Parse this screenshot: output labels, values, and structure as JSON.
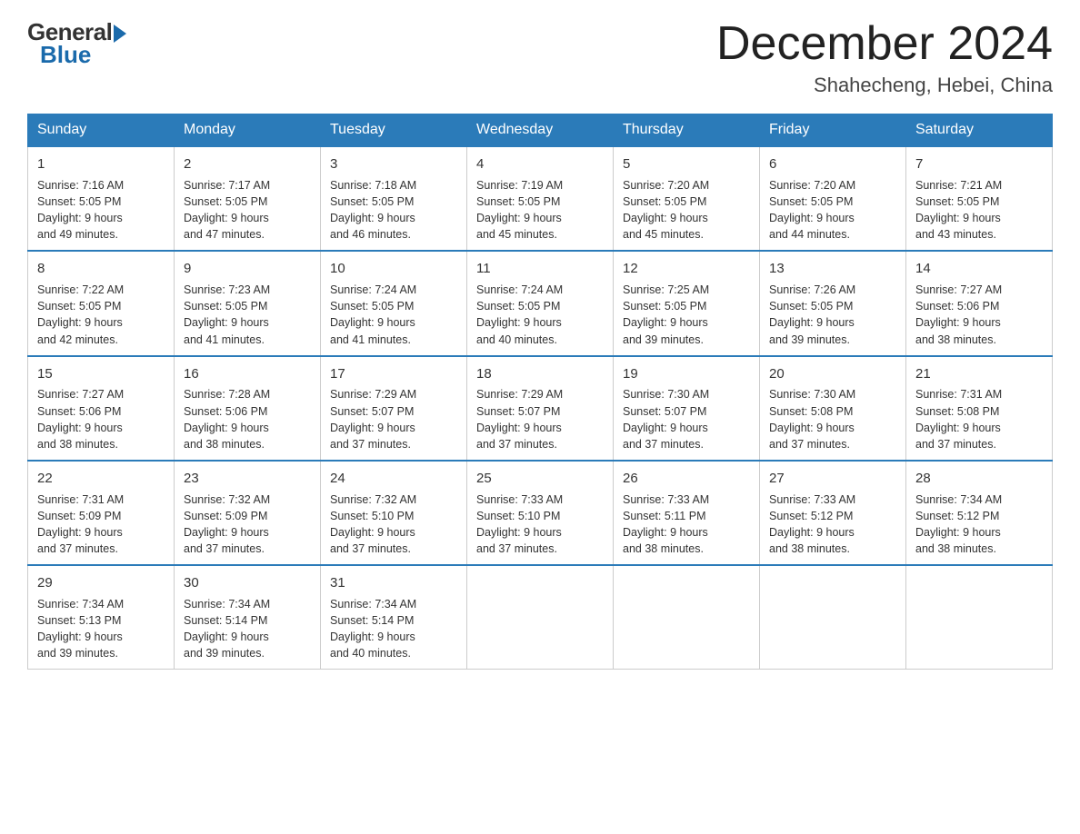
{
  "logo": {
    "general": "General",
    "blue": "Blue"
  },
  "title": "December 2024",
  "location": "Shahecheng, Hebei, China",
  "headers": [
    "Sunday",
    "Monday",
    "Tuesday",
    "Wednesday",
    "Thursday",
    "Friday",
    "Saturday"
  ],
  "weeks": [
    [
      {
        "day": "1",
        "info": "Sunrise: 7:16 AM\nSunset: 5:05 PM\nDaylight: 9 hours\nand 49 minutes."
      },
      {
        "day": "2",
        "info": "Sunrise: 7:17 AM\nSunset: 5:05 PM\nDaylight: 9 hours\nand 47 minutes."
      },
      {
        "day": "3",
        "info": "Sunrise: 7:18 AM\nSunset: 5:05 PM\nDaylight: 9 hours\nand 46 minutes."
      },
      {
        "day": "4",
        "info": "Sunrise: 7:19 AM\nSunset: 5:05 PM\nDaylight: 9 hours\nand 45 minutes."
      },
      {
        "day": "5",
        "info": "Sunrise: 7:20 AM\nSunset: 5:05 PM\nDaylight: 9 hours\nand 45 minutes."
      },
      {
        "day": "6",
        "info": "Sunrise: 7:20 AM\nSunset: 5:05 PM\nDaylight: 9 hours\nand 44 minutes."
      },
      {
        "day": "7",
        "info": "Sunrise: 7:21 AM\nSunset: 5:05 PM\nDaylight: 9 hours\nand 43 minutes."
      }
    ],
    [
      {
        "day": "8",
        "info": "Sunrise: 7:22 AM\nSunset: 5:05 PM\nDaylight: 9 hours\nand 42 minutes."
      },
      {
        "day": "9",
        "info": "Sunrise: 7:23 AM\nSunset: 5:05 PM\nDaylight: 9 hours\nand 41 minutes."
      },
      {
        "day": "10",
        "info": "Sunrise: 7:24 AM\nSunset: 5:05 PM\nDaylight: 9 hours\nand 41 minutes."
      },
      {
        "day": "11",
        "info": "Sunrise: 7:24 AM\nSunset: 5:05 PM\nDaylight: 9 hours\nand 40 minutes."
      },
      {
        "day": "12",
        "info": "Sunrise: 7:25 AM\nSunset: 5:05 PM\nDaylight: 9 hours\nand 39 minutes."
      },
      {
        "day": "13",
        "info": "Sunrise: 7:26 AM\nSunset: 5:05 PM\nDaylight: 9 hours\nand 39 minutes."
      },
      {
        "day": "14",
        "info": "Sunrise: 7:27 AM\nSunset: 5:06 PM\nDaylight: 9 hours\nand 38 minutes."
      }
    ],
    [
      {
        "day": "15",
        "info": "Sunrise: 7:27 AM\nSunset: 5:06 PM\nDaylight: 9 hours\nand 38 minutes."
      },
      {
        "day": "16",
        "info": "Sunrise: 7:28 AM\nSunset: 5:06 PM\nDaylight: 9 hours\nand 38 minutes."
      },
      {
        "day": "17",
        "info": "Sunrise: 7:29 AM\nSunset: 5:07 PM\nDaylight: 9 hours\nand 37 minutes."
      },
      {
        "day": "18",
        "info": "Sunrise: 7:29 AM\nSunset: 5:07 PM\nDaylight: 9 hours\nand 37 minutes."
      },
      {
        "day": "19",
        "info": "Sunrise: 7:30 AM\nSunset: 5:07 PM\nDaylight: 9 hours\nand 37 minutes."
      },
      {
        "day": "20",
        "info": "Sunrise: 7:30 AM\nSunset: 5:08 PM\nDaylight: 9 hours\nand 37 minutes."
      },
      {
        "day": "21",
        "info": "Sunrise: 7:31 AM\nSunset: 5:08 PM\nDaylight: 9 hours\nand 37 minutes."
      }
    ],
    [
      {
        "day": "22",
        "info": "Sunrise: 7:31 AM\nSunset: 5:09 PM\nDaylight: 9 hours\nand 37 minutes."
      },
      {
        "day": "23",
        "info": "Sunrise: 7:32 AM\nSunset: 5:09 PM\nDaylight: 9 hours\nand 37 minutes."
      },
      {
        "day": "24",
        "info": "Sunrise: 7:32 AM\nSunset: 5:10 PM\nDaylight: 9 hours\nand 37 minutes."
      },
      {
        "day": "25",
        "info": "Sunrise: 7:33 AM\nSunset: 5:10 PM\nDaylight: 9 hours\nand 37 minutes."
      },
      {
        "day": "26",
        "info": "Sunrise: 7:33 AM\nSunset: 5:11 PM\nDaylight: 9 hours\nand 38 minutes."
      },
      {
        "day": "27",
        "info": "Sunrise: 7:33 AM\nSunset: 5:12 PM\nDaylight: 9 hours\nand 38 minutes."
      },
      {
        "day": "28",
        "info": "Sunrise: 7:34 AM\nSunset: 5:12 PM\nDaylight: 9 hours\nand 38 minutes."
      }
    ],
    [
      {
        "day": "29",
        "info": "Sunrise: 7:34 AM\nSunset: 5:13 PM\nDaylight: 9 hours\nand 39 minutes."
      },
      {
        "day": "30",
        "info": "Sunrise: 7:34 AM\nSunset: 5:14 PM\nDaylight: 9 hours\nand 39 minutes."
      },
      {
        "day": "31",
        "info": "Sunrise: 7:34 AM\nSunset: 5:14 PM\nDaylight: 9 hours\nand 40 minutes."
      },
      {
        "day": "",
        "info": ""
      },
      {
        "day": "",
        "info": ""
      },
      {
        "day": "",
        "info": ""
      },
      {
        "day": "",
        "info": ""
      }
    ]
  ]
}
